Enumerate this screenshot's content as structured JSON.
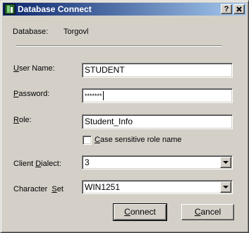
{
  "window": {
    "title": "Database Connect",
    "help_button": "?",
    "close_button": "X"
  },
  "info": {
    "database_label": "Database:",
    "database_value": "Torgovl"
  },
  "form": {
    "user_name": {
      "label_pre": "",
      "label_accel": "U",
      "label_post": "ser Name:",
      "value": "STUDENT"
    },
    "password": {
      "label_pre": "",
      "label_accel": "P",
      "label_post": "assword:",
      "value": "*******"
    },
    "role": {
      "label_pre": "",
      "label_accel": "R",
      "label_post": "ole:",
      "value": "Student_Info"
    },
    "case_sensitive": {
      "label_pre": "",
      "label_accel": "C",
      "label_post": "ase sensitive role name",
      "checked": false
    },
    "client_dialect": {
      "label_pre": "Client ",
      "label_accel": "D",
      "label_post": "ialect:",
      "value": "3"
    },
    "character_set": {
      "label_pre": "Character  ",
      "label_accel": "S",
      "label_post": "et",
      "value": "WIN1251"
    }
  },
  "buttons": {
    "connect": {
      "label_pre": "",
      "label_accel": "C",
      "label_post": "onnect"
    },
    "cancel": {
      "label_pre": "",
      "label_accel": "C",
      "label_post": "ancel"
    }
  },
  "colors": {
    "title_start": "#0a246a",
    "title_end": "#a6caf0",
    "face": "#d4d0c8"
  },
  "icons": {
    "title": "database-app-icon",
    "combo": "chevron-down-icon"
  }
}
